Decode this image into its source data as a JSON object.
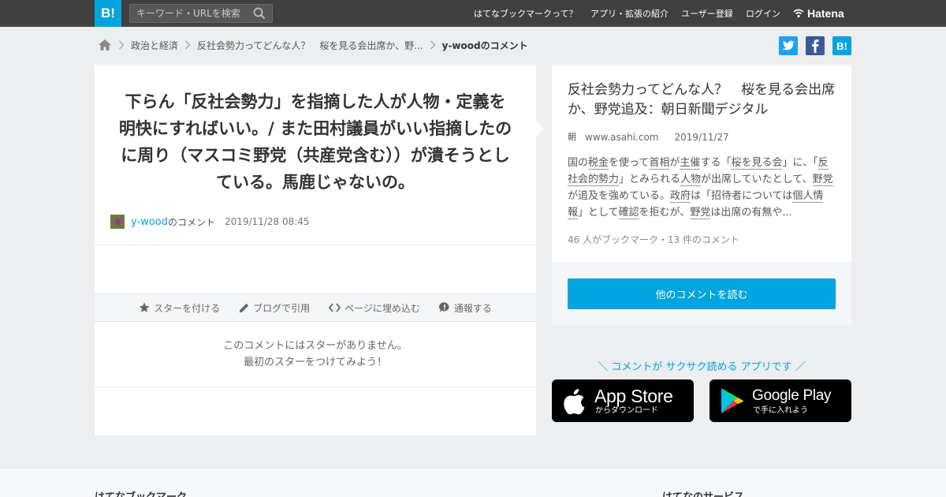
{
  "header": {
    "logo": "B!",
    "search_placeholder": "キーワード・URLを検索",
    "nav": [
      "はてなブックマークって？",
      "アプリ・拡張の紹介",
      "ユーザー登録",
      "ログイン"
    ],
    "brand": "Hatena"
  },
  "breadcrumb": {
    "items": [
      "政治と経済",
      "反社会勢力ってどんな人？　桜を見る会出席か、野..."
    ],
    "current": "y-woodのコメント"
  },
  "share": {
    "hatena_label": "B!"
  },
  "comment": {
    "text": "下らん「反社会勢力」を指摘した人が人物・定義を明快にすればいい。/ また田村議員がいい指摘したのに周り（マスコミ野党（共産党含む））が潰そうとしている。馬鹿じゃないの。",
    "user": "y-wood",
    "suffix": "のコメント",
    "timestamp": "2019/11/28 08:45",
    "actions": [
      "スターを付ける",
      "ブログで引用",
      "ページに埋め込む",
      "通報する"
    ],
    "no_star_line1": "このコメントにはスターがありません。",
    "no_star_line2": "最初のスターをつけてみよう！"
  },
  "entry": {
    "title": "反社会勢力ってどんな人？　桜を見る会出席か、野党追及：朝日新聞デジタル",
    "favicon": "朝",
    "domain": "www.asahi.com",
    "date": "2019/11/27",
    "desc": [
      {
        "t": "国の"
      },
      {
        "t": "税金",
        "k": true
      },
      {
        "t": "を使って"
      },
      {
        "t": "首相",
        "k": true
      },
      {
        "t": "が"
      },
      {
        "t": "主催",
        "k": true
      },
      {
        "t": "する「"
      },
      {
        "t": "桜を見る会",
        "k": true
      },
      {
        "t": "」に、「"
      },
      {
        "t": "反社会的勢力",
        "k": true
      },
      {
        "t": "」とみられる"
      },
      {
        "t": "人物",
        "k": true
      },
      {
        "t": "が出席していたとして、"
      },
      {
        "t": "野党",
        "k": true
      },
      {
        "t": "が追及を強めている。"
      },
      {
        "t": "政府",
        "k": true
      },
      {
        "t": "は「招待者については"
      },
      {
        "t": "個人情報",
        "k": true
      },
      {
        "t": "」として"
      },
      {
        "t": "確認",
        "k": true
      },
      {
        "t": "を拒むが、"
      },
      {
        "t": "野党",
        "k": true
      },
      {
        "t": "は出席の有無や..."
      }
    ],
    "count": "46 人がブックマーク・13 件のコメント",
    "read_button": "他のコメントを読む"
  },
  "promo": {
    "text": "＼ コメントが サクサク読める アプリです ／",
    "appstore_big": "App Store",
    "appstore_small": "からダウンロード",
    "googleplay_big": "Google Play",
    "googleplay_small": "で手に入れよう"
  },
  "footer": {
    "left_heading": "はてなブックマーク",
    "right_heading": "はてなのサービス"
  },
  "colors": {
    "accent": "#00a4de",
    "header_bg": "#404040",
    "twitter": "#1da1f2",
    "facebook": "#3b5998"
  }
}
